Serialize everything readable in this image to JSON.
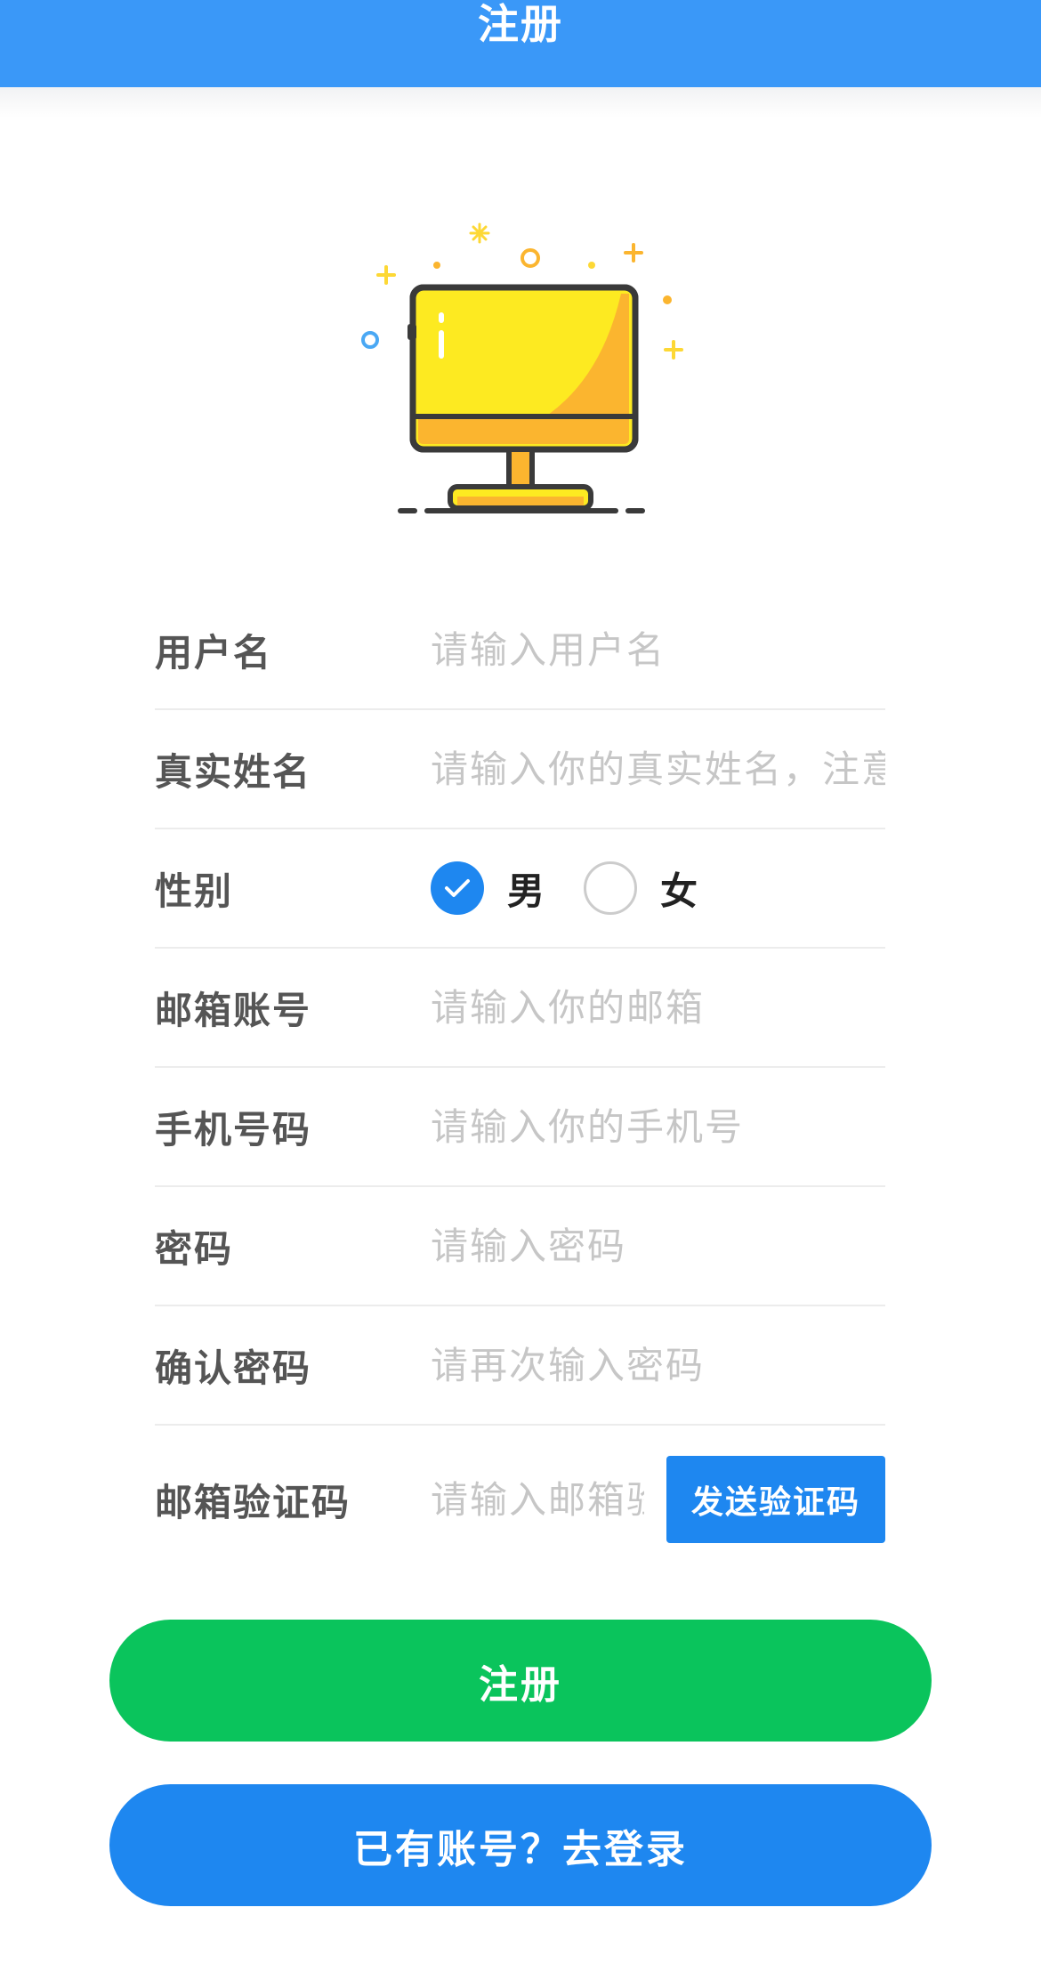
{
  "header": {
    "title": "注册"
  },
  "illustration": {
    "icon": "computer-monitor-icon"
  },
  "form": {
    "username": {
      "label": "用户名",
      "placeholder": "请输入用户名"
    },
    "realname": {
      "label": "真实姓名",
      "placeholder": "请输入你的真实姓名，注意"
    },
    "gender": {
      "label": "性别",
      "options": [
        {
          "label": "男",
          "checked": true
        },
        {
          "label": "女",
          "checked": false
        }
      ]
    },
    "email": {
      "label": "邮箱账号",
      "placeholder": "请输入你的邮箱"
    },
    "phone": {
      "label": "手机号码",
      "placeholder": "请输入你的手机号"
    },
    "password": {
      "label": "密码",
      "placeholder": "请输入密码"
    },
    "confirm_password": {
      "label": "确认密码",
      "placeholder": "请再次输入密码"
    },
    "email_code": {
      "label": "邮箱验证码",
      "placeholder": "请输入邮箱验证码",
      "send_label": "发送验证码"
    }
  },
  "actions": {
    "register_label": "注册",
    "login_label": "已有账号？去登录"
  },
  "colors": {
    "header_blue": "#3a98f8",
    "primary_blue": "#1e87f0",
    "success_green": "#0ac45c",
    "monitor_yellow": "#fdea21",
    "monitor_orange": "#fbb52f"
  }
}
